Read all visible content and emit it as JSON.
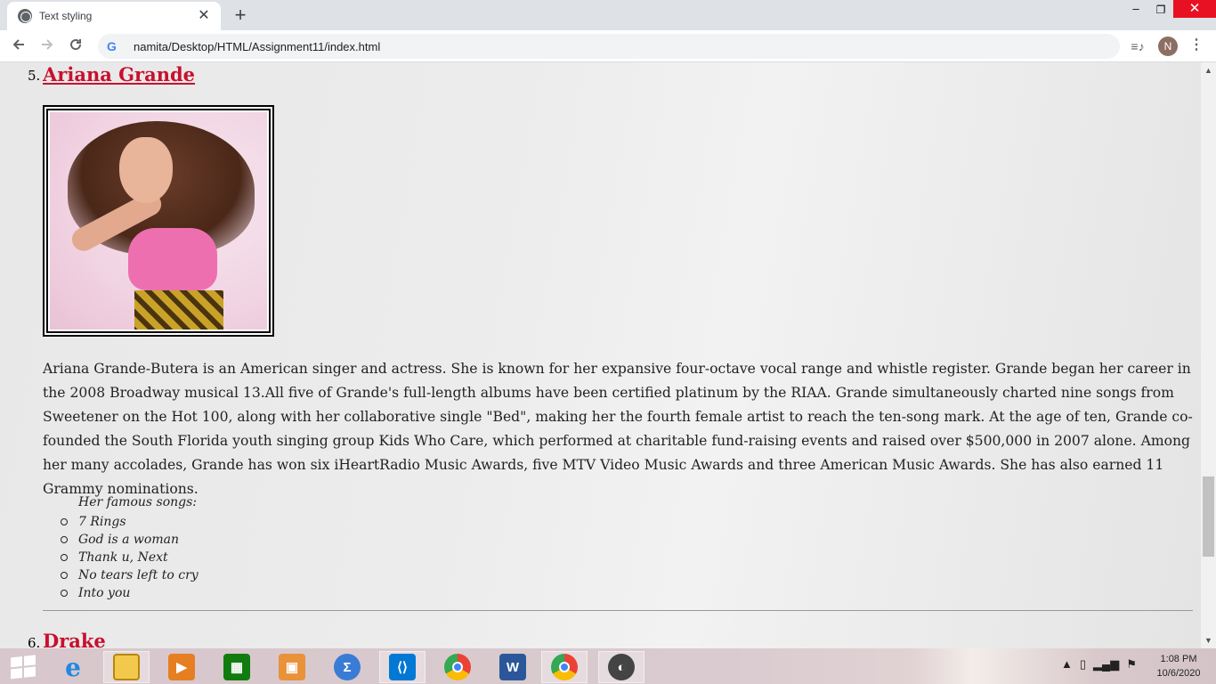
{
  "browser": {
    "tab_title": "Text styling",
    "tab_close": "✕",
    "new_tab": "+",
    "url": "namita/Desktop/HTML/Assignment11/index.html",
    "profile_initial": "N",
    "window_buttons": {
      "minimize": "–",
      "maximize": "❐",
      "close": "✕"
    }
  },
  "page": {
    "item5": {
      "number": "5.",
      "heading": "Ariana Grande",
      "bio": "Ariana Grande-Butera is an American singer and actress. She is known for her expansive four-octave vocal range and whistle register. Grande began her career in the 2008 Broadway musical 13.All five of Grande's full-length albums have been certified platinum by the RIAA. Grande simultaneously charted nine songs from Sweetener on the Hot 100, along with her collaborative single \"Bed\", making her the fourth female artist to reach the ten-song mark. At the age of ten, Grande co-founded the South Florida youth singing group Kids Who Care, which performed at charitable fund-raising events and raised over $500,000 in 2007 alone. Among her many accolades, Grande has won six iHeartRadio Music Awards, five MTV Video Music Awards and three American Music Awards. She has also earned 11 Grammy nominations.",
      "songs_caption": "Her famous songs:",
      "songs": [
        "7 Rings",
        "God is a woman",
        "Thank u, Next",
        "No tears left to cry",
        "Into you"
      ]
    },
    "item6": {
      "number": "6.",
      "heading": "Drake"
    }
  },
  "taskbar": {
    "time": "1:08 PM",
    "date": "10/6/2020",
    "apps": [
      "start-icon",
      "internet-explorer-icon",
      "file-explorer-icon",
      "media-player-icon",
      "store-icon",
      "folder-app-icon",
      "math-input-icon",
      "vscode-icon",
      "chrome-icon",
      "word-icon",
      "chrome-profile-icon",
      "speaker-app-icon"
    ]
  },
  "colors": {
    "heading_red": "#c8102e",
    "close_red": "#e81123"
  }
}
